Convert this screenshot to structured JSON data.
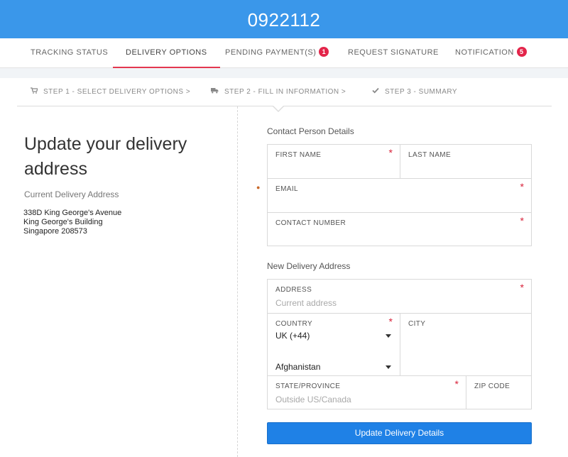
{
  "header": {
    "reference": "0922112"
  },
  "tabs": [
    {
      "label": "Tracking Status",
      "badge": ""
    },
    {
      "label": "Delivery Options",
      "badge": ""
    },
    {
      "label": "Pending Payment(s)",
      "badge": "1"
    },
    {
      "label": "Request Signature",
      "badge": ""
    },
    {
      "label": "Notification",
      "badge": "5"
    }
  ],
  "active_tab": "Delivery Options",
  "steps": [
    {
      "label": "Step 1 - Select Delivery Options >",
      "icon": "cart-icon"
    },
    {
      "label": "Step 2 - Fill in Information >",
      "icon": "truck-icon"
    },
    {
      "label": "Step 3 - Summary",
      "icon": "check-icon"
    }
  ],
  "left": {
    "title": "Update your delivery address",
    "subtitle": "Current Delivery Address",
    "address_lines": [
      "338D King George's Avenue",
      "King George's Building",
      "Singapore 208573"
    ]
  },
  "contact": {
    "section_label": "Contact Person Details",
    "first_name_label": "First Name",
    "last_name_label": "Last Name",
    "email_label": "Email",
    "contact_number_label": "Contact Number"
  },
  "delivery": {
    "section_label": "New Delivery Address",
    "address_label": "Address",
    "address_placeholder": "Current address",
    "country_label": "Country",
    "country_code_value": "UK (+44)",
    "country_value": "Afghanistan",
    "city_label": "City",
    "state_label": "State/Province",
    "state_placeholder": "Outside US/Canada",
    "zip_label": "Zip Code"
  },
  "required_mark": "*",
  "submit_label": "Update Delivery Details",
  "colors": {
    "header": "#3a97ea",
    "active_tab_underline": "#e3384f",
    "badge": "#e3254a",
    "button": "#1f81e6",
    "required": "#d8223a"
  }
}
